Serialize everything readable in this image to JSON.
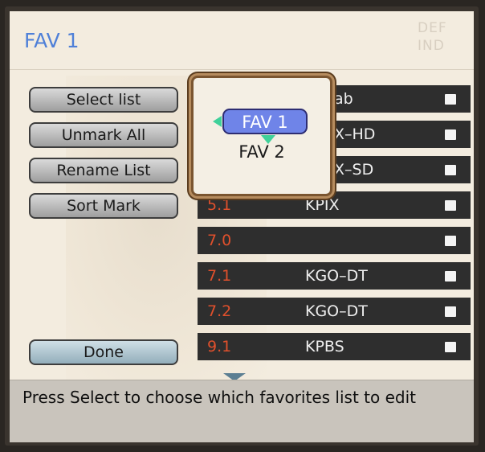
{
  "title": "FAV 1",
  "background_text": [
    "DEF",
    "IND"
  ],
  "buttons": {
    "select_list": "Select list",
    "unmark_all": "Unmark All",
    "rename_list": "Rename List",
    "sort_mark": "Sort Mark",
    "done": "Done"
  },
  "channels": [
    {
      "num": "",
      "name": "ab",
      "checked": false
    },
    {
      "num": "",
      "name": "X–HD",
      "checked": false
    },
    {
      "num": "",
      "name": "X–SD",
      "checked": false
    },
    {
      "num": "5.1",
      "name": "KPIX",
      "checked": false
    },
    {
      "num": "7.0",
      "name": "",
      "checked": false
    },
    {
      "num": "7.1",
      "name": "KGO–DT",
      "checked": false
    },
    {
      "num": "7.2",
      "name": "KGO–DT",
      "checked": false
    },
    {
      "num": "9.1",
      "name": "KPBS",
      "checked": false
    }
  ],
  "popup": {
    "selected": "FAV 1",
    "next": "FAV 2"
  },
  "help_text": "Press Select to choose which favorites list to edit",
  "colors": {
    "title": "#4f80d8",
    "channel_number": "#e0502c",
    "row_bg": "#2e2e2e",
    "selected_pill": "#6f84e8",
    "nav_arrow": "#3fd19a"
  }
}
